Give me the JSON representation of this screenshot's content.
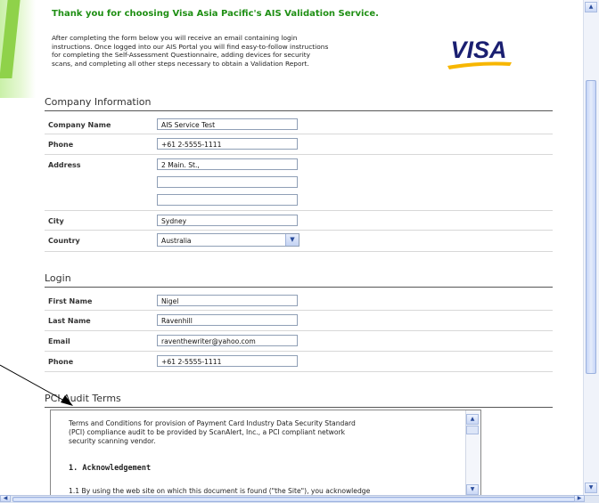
{
  "header": {
    "title": "Thank you for choosing Visa Asia Pacific's AIS Validation Service.",
    "intro_line1": "After completing the form below you will receive an email containing login",
    "intro_line2": "instructions. Once logged into our AIS Portal you will find easy-to-follow instructions",
    "intro_line3": "for completing the Self-Assessment Questionnaire, adding devices for security",
    "intro_line4": "scans, and completing all other steps necessary to obtain a Validation Report.",
    "logo_text": "VISA"
  },
  "company": {
    "section_title": "Company Information",
    "company_name_label": "Company Name",
    "company_name_value": "AIS Service Test",
    "phone_label": "Phone",
    "phone_value": "+61 2-5555-1111",
    "address_label": "Address",
    "address1_value": "2 Main. St.,",
    "address2_value": "",
    "address3_value": "",
    "city_label": "City",
    "city_value": "Sydney",
    "country_label": "Country",
    "country_value": "Australia"
  },
  "login": {
    "section_title": "Login",
    "first_name_label": "First Name",
    "first_name_value": "Nigel",
    "last_name_label": "Last Name",
    "last_name_value": "Ravenhill",
    "email_label": "Email",
    "email_value": "raventhewriter@yahoo.com",
    "phone_label": "Phone",
    "phone_value": "+61 2-5555-1111"
  },
  "terms": {
    "section_title": "PCI Audit Terms",
    "text_line1": "Terms and Conditions for provision of Payment Card Industry Data Security Standard",
    "text_line2": "(PCI) compliance audit to be provided by ScanAlert, Inc., a PCI compliant network",
    "text_line3": "security scanning vendor.",
    "heading": "1. Acknowledgement",
    "text_line4": "1.1 By using the web site on which this document is found (\"the Site\"), you acknowledge"
  },
  "colors": {
    "accent_green": "#1f8f14",
    "visa_blue": "#1a1f71",
    "visa_gold": "#f7b600"
  }
}
